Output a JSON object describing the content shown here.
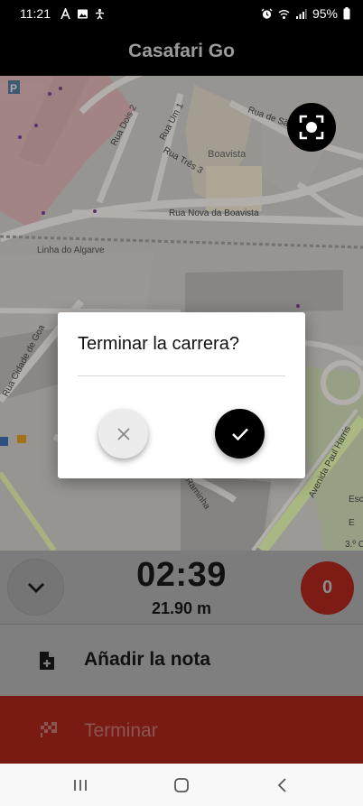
{
  "status_bar": {
    "time": "11:21",
    "battery": "95%",
    "icons_left": [
      "a-icon",
      "image-icon",
      "accessibility-icon"
    ],
    "icons_right": [
      "alarm-icon",
      "wifi-icon",
      "signal-icon",
      "battery-icon"
    ]
  },
  "app": {
    "title": "Casafari Go"
  },
  "map": {
    "labels": {
      "rua_dois": "Rua Dois 2",
      "rua_um": "Rua Um 1",
      "rua_tres": "Rua Três 3",
      "boavista": "Boavista",
      "rua_sao": "Rua de São",
      "rua_nova": "Rua Nova da Boavista",
      "linha": "Linha do Algarve",
      "rua_cidade": "Rua Cidade de Goa",
      "avenida": "Avenida Paul Harris",
      "raminha": "Raminha",
      "p_sign": "P",
      "edge_es": "Esc",
      "edge_e": "E",
      "edge_3": "3.º C"
    }
  },
  "dialog": {
    "title": "Terminar la carrera?",
    "cancel_icon": "close-icon",
    "confirm_icon": "check-icon"
  },
  "panel": {
    "timer": "02:39",
    "distance": "21.90 m",
    "counter": "0",
    "note_label": "Añadir la nota",
    "finish_label": "Terminar"
  },
  "colors": {
    "finish_bg": "#7a1b13",
    "badge_bg": "#7c1c14",
    "overlay_dim": "rgba(0,0,0,0.5)"
  }
}
